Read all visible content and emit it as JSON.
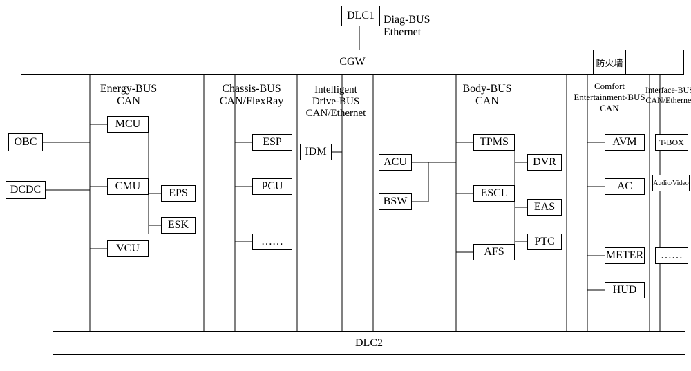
{
  "top": {
    "dlc1": "DLC1",
    "diag": "Diag-BUS\nEthernet"
  },
  "cgw": {
    "label": "CGW",
    "firewall": "防火墙"
  },
  "columns": {
    "energy": {
      "title": "Energy-BUS\nCAN"
    },
    "chassis": {
      "title": "Chassis-BUS\nCAN/FlexRay"
    },
    "idrive": {
      "title": "Intelligent\nDrive-BUS\nCAN/Ethernet"
    },
    "body": {
      "title": "Body-BUS\nCAN"
    },
    "comfort": {
      "title": "Comfort\nEntertainment-BUS\nCAN"
    },
    "interface": {
      "title": "Interface-BUS\nCAN/Ethernet"
    }
  },
  "nodes": {
    "obc": "OBC",
    "dcdc": "DCDC",
    "mcu": "MCU",
    "cmu": "CMU",
    "vcu": "VCU",
    "eps": "EPS",
    "esk": "ESK",
    "esp": "ESP",
    "pcu": "PCU",
    "chassis_more": "……",
    "idm": "IDM",
    "acu": "ACU",
    "bsw": "BSW",
    "tpms": "TPMS",
    "escl": "ESCL",
    "afs": "AFS",
    "dvr": "DVR",
    "eas": "EAS",
    "ptc": "PTC",
    "avm": "AVM",
    "ac": "AC",
    "meter": "METER",
    "hud": "HUD",
    "tbox": "T-BOX",
    "av": "Audio/Video",
    "interface_more": "……"
  },
  "bottom": {
    "dlc2": "DLC2"
  }
}
